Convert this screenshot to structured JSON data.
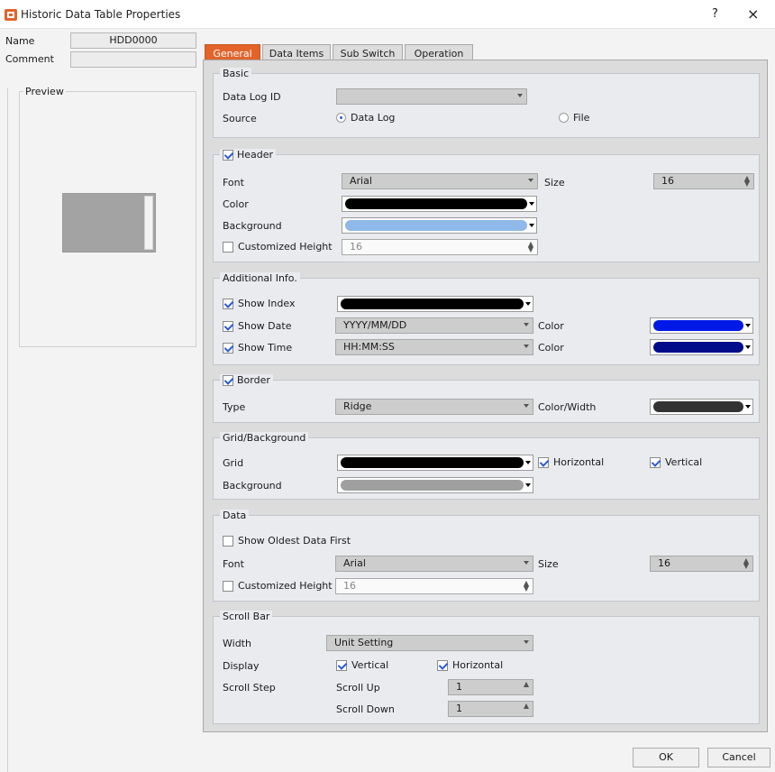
{
  "window": {
    "title": "Historic Data Table Properties",
    "help": "?",
    "close": "×"
  },
  "left": {
    "name_label": "Name",
    "name_value": "HDD0000",
    "comment_label": "Comment",
    "comment_value": "",
    "preview_label": "Preview"
  },
  "tabs": [
    "General",
    "Data Items",
    "Sub Switch",
    "Operation"
  ],
  "basic": {
    "title": "Basic",
    "data_log_id_label": "Data Log ID",
    "data_log_id_value": "",
    "source_label": "Source",
    "source_options": [
      "Data Log",
      "File"
    ],
    "source_selected": "Data Log"
  },
  "header": {
    "title": "Header",
    "enabled": true,
    "font_label": "Font",
    "font_value": "Arial",
    "size_label": "Size",
    "size_value": "16",
    "color_label": "Color",
    "color_value": "#000000",
    "background_label": "Background",
    "background_value": "#8fb9e8",
    "customized_height_label": "Customized Height",
    "customized_height_checked": false,
    "customized_height_value": "16"
  },
  "additional": {
    "title": "Additional Info.",
    "show_index_label": "Show Index",
    "show_index_checked": true,
    "show_index_color": "#000000",
    "show_date_label": "Show Date",
    "show_date_checked": true,
    "date_format": "YYYY/MM/DD",
    "date_color": "#0019e6",
    "show_time_label": "Show Time",
    "show_time_checked": true,
    "time_format": "HH:MM:SS",
    "time_color": "#000c8a",
    "color_label": "Color"
  },
  "border": {
    "title": "Border",
    "enabled": true,
    "type_label": "Type",
    "type_value": "Ridge",
    "color_width_label": "Color/Width",
    "color_width_value": "#333333"
  },
  "grid": {
    "title": "Grid/Background",
    "grid_label": "Grid",
    "grid_color": "#000000",
    "horizontal_label": "Horizontal",
    "horizontal_checked": true,
    "vertical_label": "Vertical",
    "vertical_checked": true,
    "background_label": "Background",
    "background_color": "#a0a0a0"
  },
  "data": {
    "title": "Data",
    "oldest_first_label": "Show Oldest Data First",
    "oldest_first_checked": false,
    "font_label": "Font",
    "font_value": "Arial",
    "size_label": "Size",
    "size_value": "16",
    "customized_height_label": "Customized Height",
    "customized_height_checked": false,
    "customized_height_value": "16"
  },
  "scrollbar": {
    "title": "Scroll Bar",
    "width_label": "Width",
    "width_value": "Unit Setting",
    "display_label": "Display",
    "vertical_label": "Vertical",
    "vertical_checked": true,
    "horizontal_label": "Horizontal",
    "horizontal_checked": true,
    "scroll_step_label": "Scroll Step",
    "scroll_up_label": "Scroll Up",
    "scroll_up_value": "1",
    "scroll_down_label": "Scroll Down",
    "scroll_down_value": "1"
  },
  "buttons": {
    "ok": "OK",
    "cancel": "Cancel"
  }
}
